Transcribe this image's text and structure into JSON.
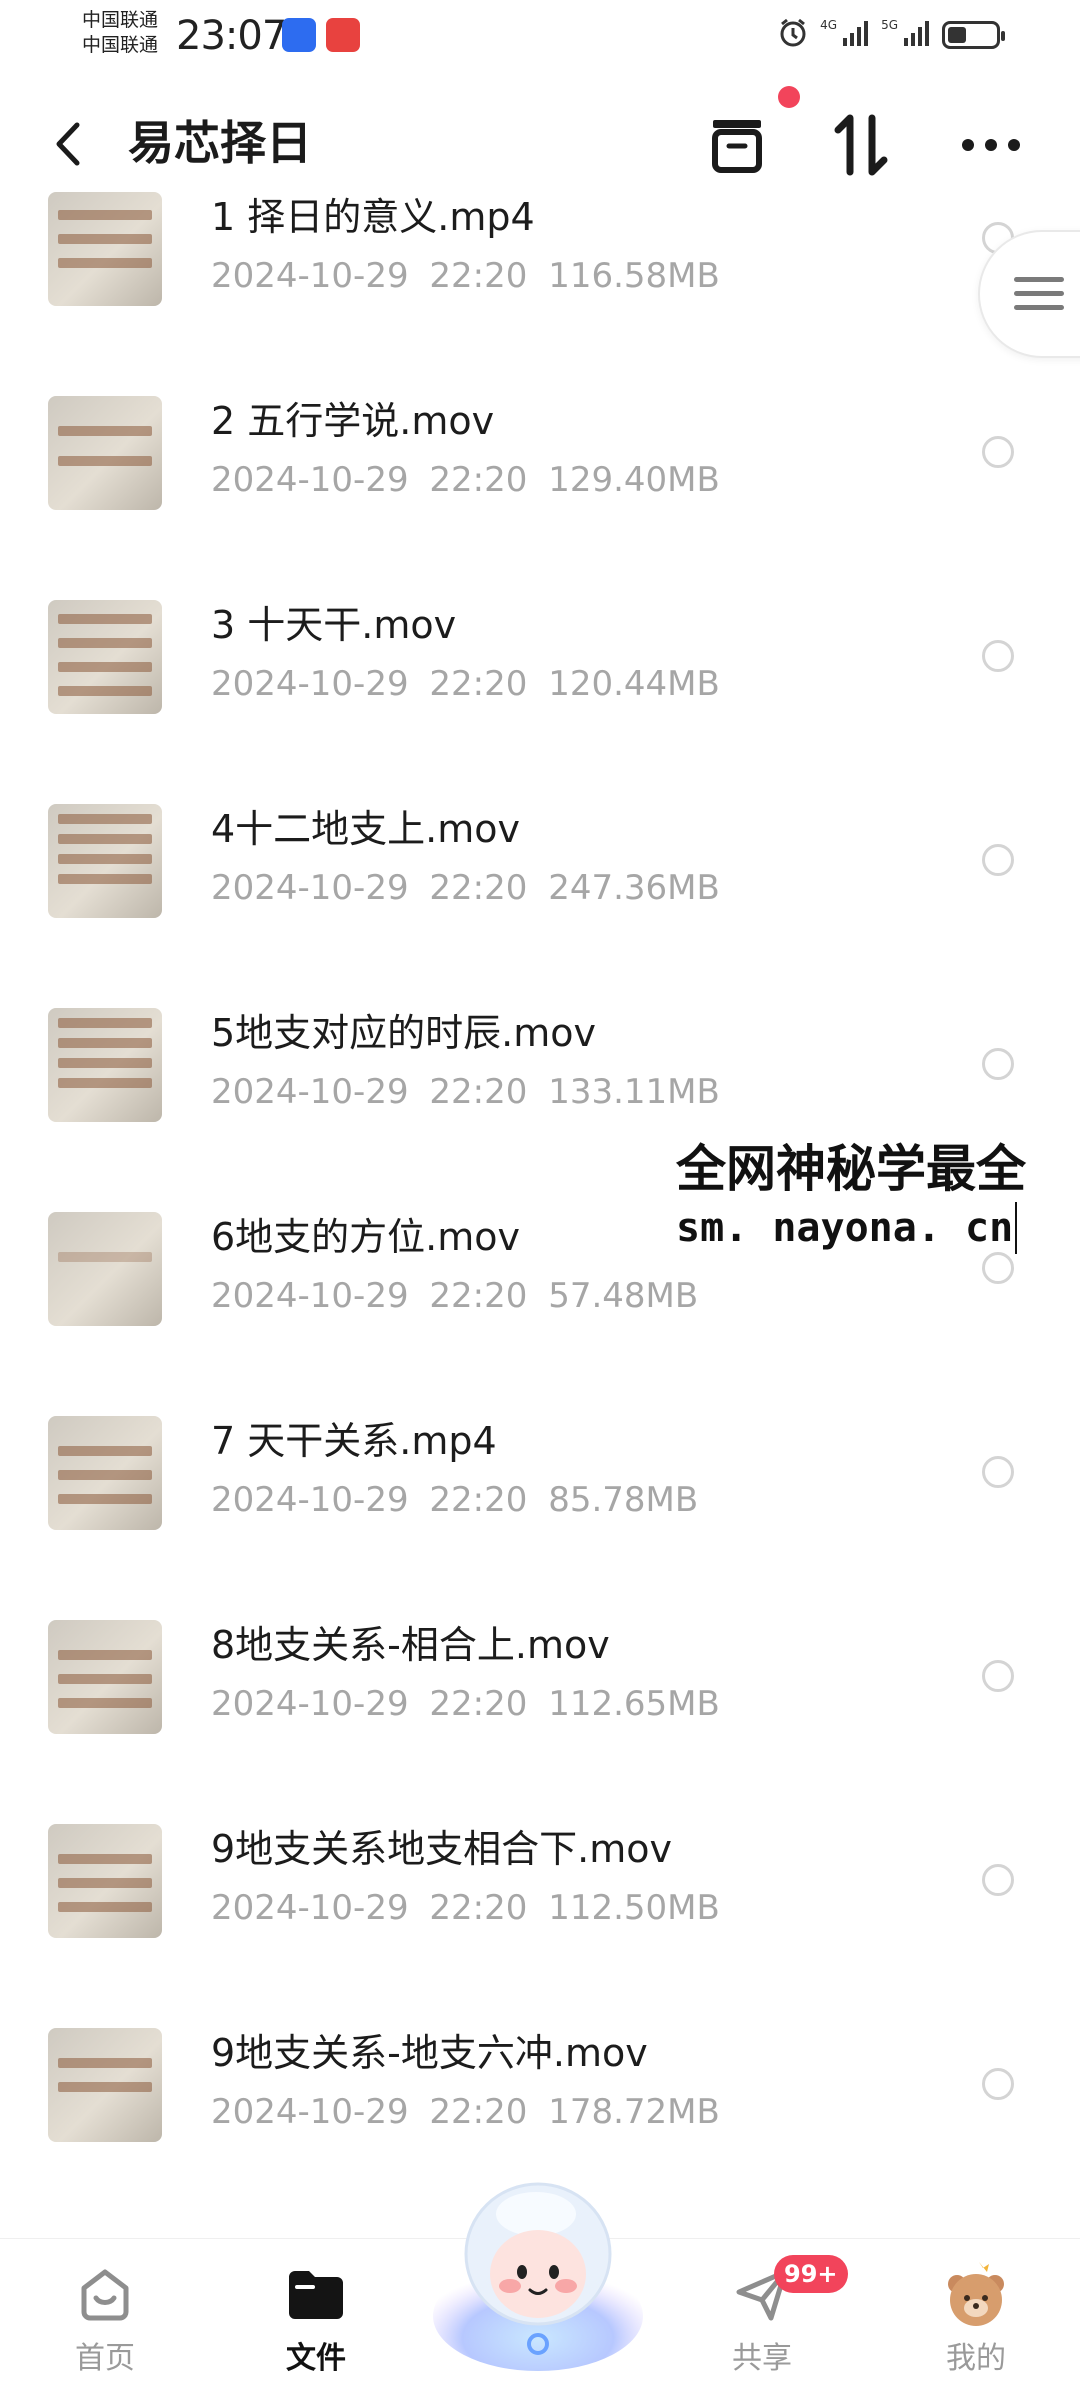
{
  "status_bar": {
    "carrier_1": "中国联通",
    "carrier_2": "中国联通",
    "time": "23:07",
    "network_1": "4G",
    "network_2": "5G",
    "battery_level": 0.4
  },
  "header": {
    "title": "易芯择日"
  },
  "files": [
    {
      "name": "1 择日的意义.mp4",
      "date": "2024-10-29",
      "time": "22:20",
      "size": "116.58MB"
    },
    {
      "name": "2 五行学说.mov",
      "date": "2024-10-29",
      "time": "22:20",
      "size": "129.40MB"
    },
    {
      "name": "3 十天干.mov",
      "date": "2024-10-29",
      "time": "22:20",
      "size": "120.44MB"
    },
    {
      "name": "4十二地支上.mov",
      "date": "2024-10-29",
      "time": "22:20",
      "size": "247.36MB"
    },
    {
      "name": "5地支对应的时辰.mov",
      "date": "2024-10-29",
      "time": "22:20",
      "size": "133.11MB"
    },
    {
      "name": "6地支的方位.mov",
      "date": "2024-10-29",
      "time": "22:20",
      "size": "57.48MB"
    },
    {
      "name": "7 天干关系.mp4",
      "date": "2024-10-29",
      "time": "22:20",
      "size": "85.78MB"
    },
    {
      "name": "8地支关系-相合上.mov",
      "date": "2024-10-29",
      "time": "22:20",
      "size": "112.65MB"
    },
    {
      "name": "9地支关系地支相合下.mov",
      "date": "2024-10-29",
      "time": "22:20",
      "size": "112.50MB"
    },
    {
      "name": "9地支关系-地支六冲.mov",
      "date": "2024-10-29",
      "time": "22:20",
      "size": "178.72MB"
    }
  ],
  "watermark": {
    "line1": "全网神秘学最全",
    "line2": "sm. nayona. cn"
  },
  "bottom_nav": {
    "home": "首页",
    "files": "文件",
    "share": "共享",
    "share_badge": "99+",
    "mine": "我的"
  },
  "colors": {
    "accent_red": "#f2445b",
    "meta_gray": "#a6a6a6"
  }
}
